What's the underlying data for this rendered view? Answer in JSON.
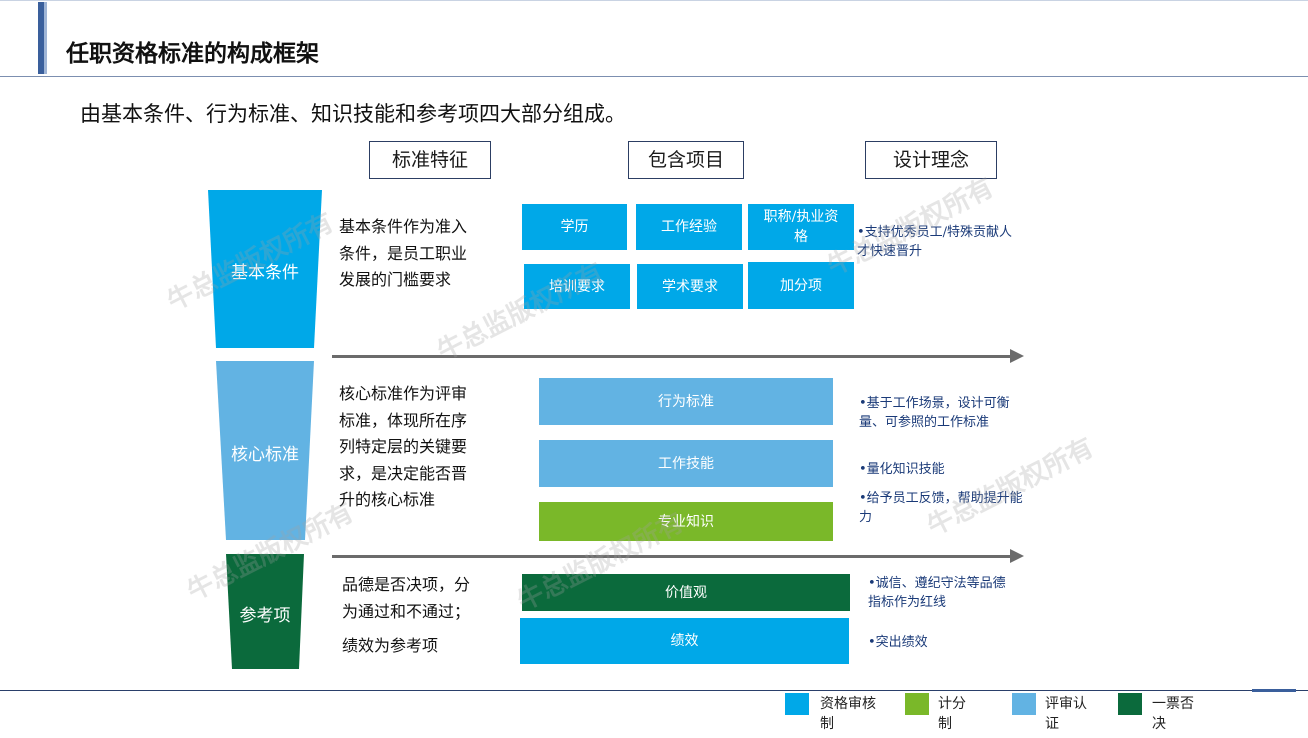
{
  "title": "任职资格标准的构成框架",
  "subtitle": "由基本条件、行为标准、知识技能和参考项四大部分组成。",
  "column_headers": [
    "标准特征",
    "包含项目",
    "设计理念"
  ],
  "tiers": [
    {
      "label": "基本条件",
      "description_lines": [
        "基本条件作为准入",
        "条件，是员工职业",
        "发展的门槛要求"
      ],
      "items": [
        "学历",
        "工作经验",
        "职称/执业资格",
        "培训要求",
        "学术要求",
        "加分项"
      ],
      "notes": [
        "•支持优秀员工/特殊贡献人才快速晋升"
      ]
    },
    {
      "label": "核心标准",
      "description_lines": [
        "核心标准作为评审",
        "标准，体现所在序",
        "列特定层的关键要",
        "求，是决定能否晋",
        "升的核心标准"
      ],
      "items": [
        "行为标准",
        "工作技能",
        "专业知识"
      ],
      "notes": [
        "•基于工作场景，设计可衡量、可参照的工作标准",
        "•量化知识技能",
        "•给予员工反馈，帮助提升能力"
      ]
    },
    {
      "label": "参考项",
      "description_lines": [
        "品德是否决项，分",
        "为通过和不通过；",
        "绩效为参考项"
      ],
      "items": [
        "价值观",
        "绩效"
      ],
      "notes": [
        "•诚信、遵纪守法等品德指标作为红线",
        "•突出绩效"
      ]
    }
  ],
  "legend": [
    {
      "label": "资格审核制",
      "color": "#00a8e8"
    },
    {
      "label": "计分制",
      "color": "#7ab829"
    },
    {
      "label": "评审认证",
      "color": "#62b3e3"
    },
    {
      "label": "一票否决",
      "color": "#0b6a3c"
    }
  ],
  "watermark": "牛总监版权所有",
  "colors": {
    "accent": "#3a5f9c",
    "blue": "#00a8e8",
    "light_blue": "#62b3e3",
    "green": "#7ab829",
    "dark_green": "#0b6a3c"
  }
}
